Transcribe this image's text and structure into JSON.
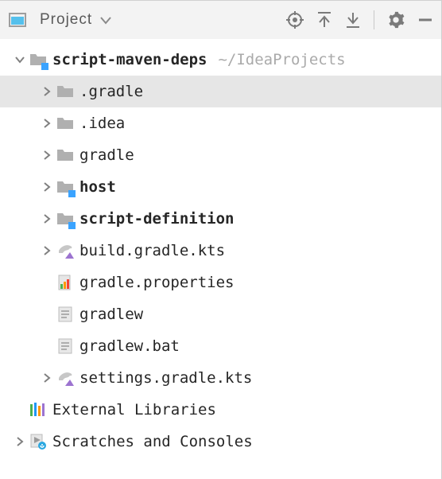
{
  "toolbar": {
    "title": "Project"
  },
  "tree": {
    "root": {
      "name": "script-maven-deps",
      "path": "~/IdeaProjects"
    },
    "items": [
      {
        "name": ".gradle"
      },
      {
        "name": ".idea"
      },
      {
        "name": "gradle"
      },
      {
        "name": "host"
      },
      {
        "name": "script-definition"
      },
      {
        "name": "build.gradle.kts"
      },
      {
        "name": "gradle.properties"
      },
      {
        "name": "gradlew"
      },
      {
        "name": "gradlew.bat"
      },
      {
        "name": "settings.gradle.kts"
      }
    ],
    "external_libs": "External Libraries",
    "scratches": "Scratches and Consoles"
  }
}
